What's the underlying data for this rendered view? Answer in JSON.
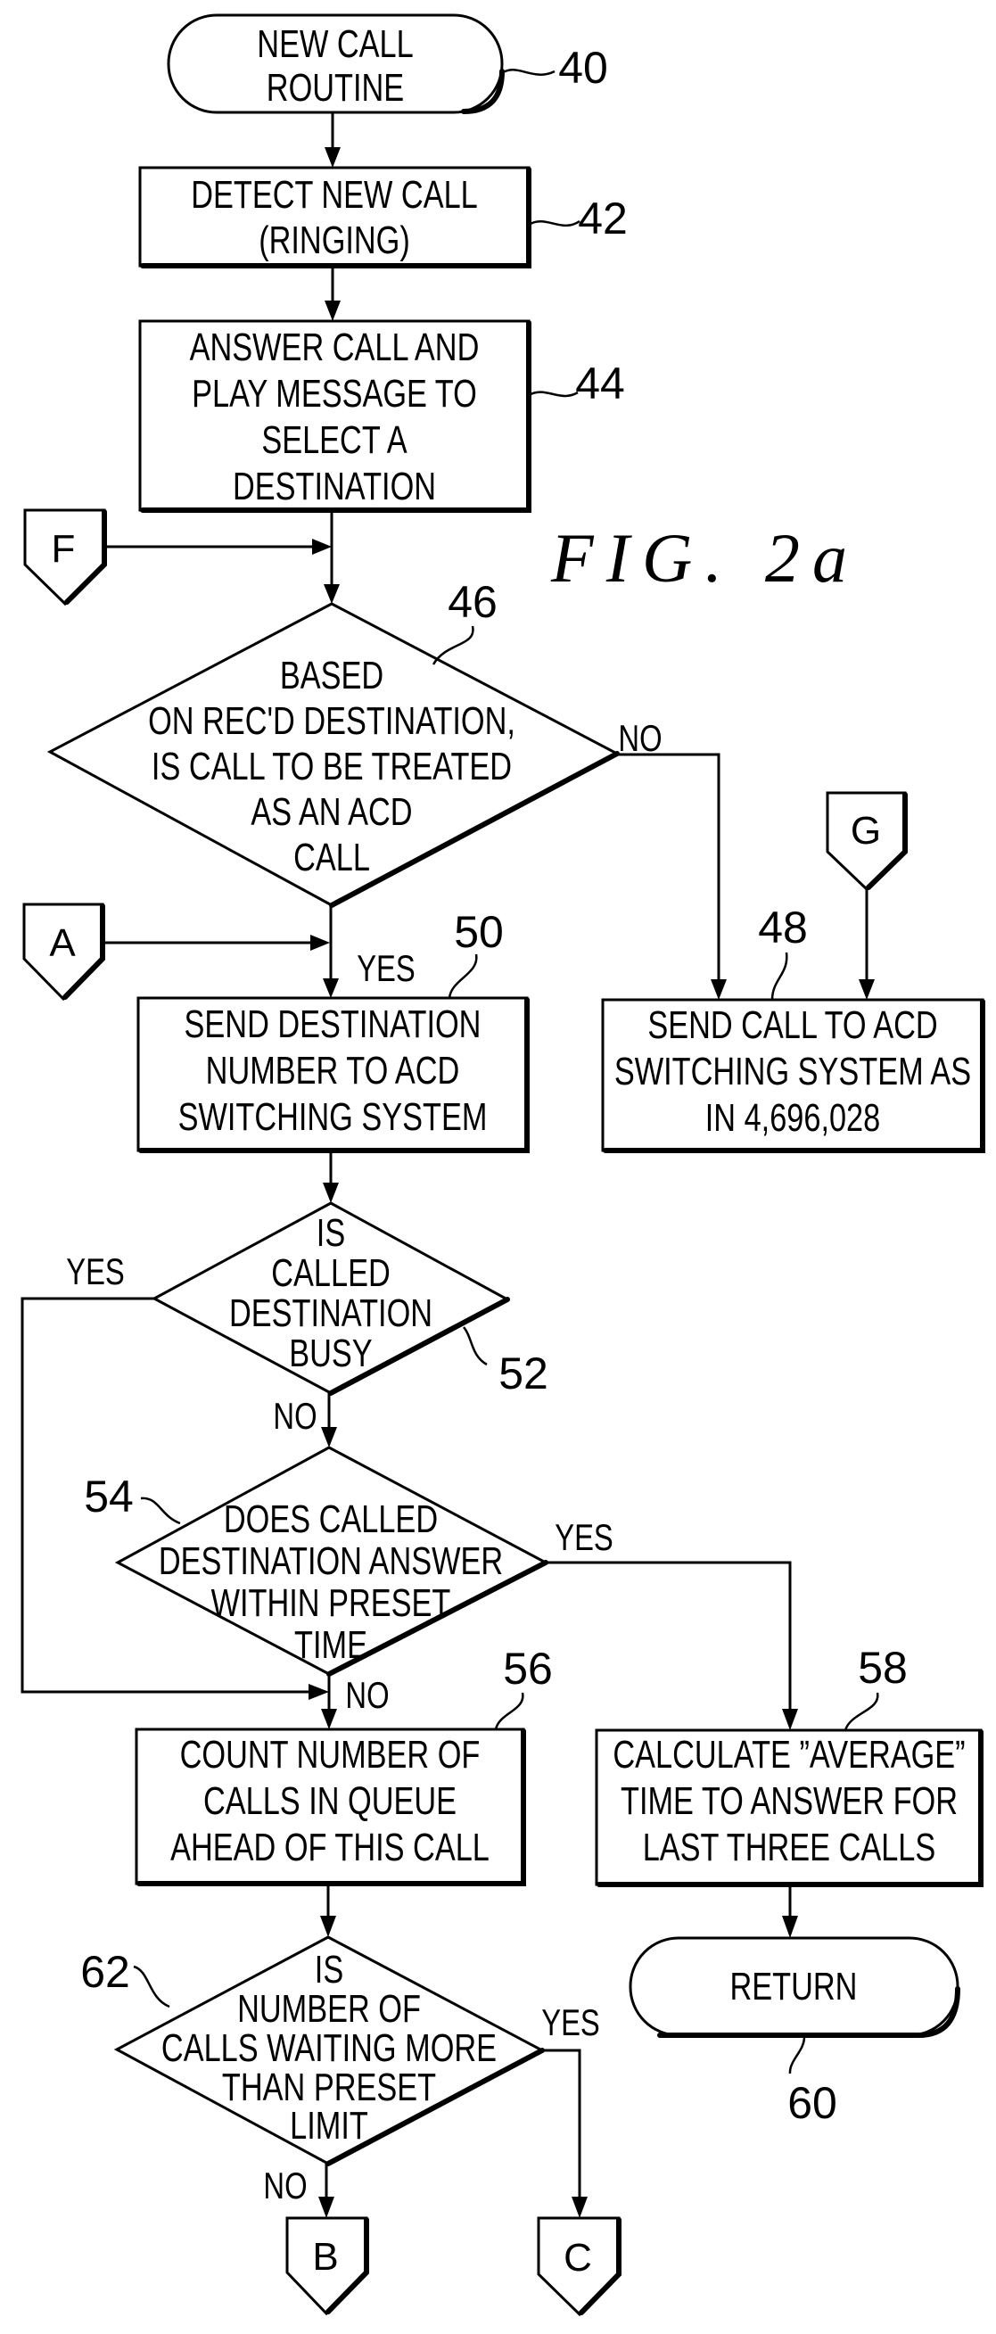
{
  "figure_title": "FIG.  2a",
  "nodes": {
    "n40": {
      "ref": "40",
      "lines": [
        "NEW CALL",
        "ROUTINE"
      ]
    },
    "n42": {
      "ref": "42",
      "lines": [
        "DETECT NEW CALL",
        "(RINGING)"
      ]
    },
    "n44": {
      "ref": "44",
      "lines": [
        "ANSWER CALL AND",
        "PLAY MESSAGE TO",
        "SELECT A",
        "DESTINATION"
      ]
    },
    "n46": {
      "ref": "46",
      "lines": [
        "BASED",
        "ON REC'D DESTINATION,",
        "IS CALL TO BE TREATED",
        "AS AN ACD",
        "CALL"
      ]
    },
    "n48": {
      "ref": "48",
      "lines": [
        "SEND CALL TO ACD",
        "SWITCHING SYSTEM AS",
        "IN 4,696,028"
      ]
    },
    "n50": {
      "ref": "50",
      "lines": [
        "SEND DESTINATION",
        "NUMBER TO ACD",
        "SWITCHING SYSTEM"
      ]
    },
    "n52": {
      "ref": "52",
      "lines": [
        "IS",
        "CALLED",
        "DESTINATION",
        "BUSY"
      ]
    },
    "n54": {
      "ref": "54",
      "lines": [
        "DOES CALLED",
        "DESTINATION ANSWER",
        "WITHIN PRESET",
        "TIME"
      ]
    },
    "n56": {
      "ref": "56",
      "lines": [
        "COUNT NUMBER OF",
        "CALLS IN QUEUE",
        "AHEAD OF THIS CALL"
      ]
    },
    "n58": {
      "ref": "58",
      "lines": [
        "CALCULATE ”AVERAGE”",
        "TIME TO ANSWER FOR",
        "LAST THREE CALLS"
      ]
    },
    "n60": {
      "ref": "60",
      "lines": [
        "RETURN"
      ]
    },
    "n62": {
      "ref": "62",
      "lines": [
        "IS",
        "NUMBER OF",
        "CALLS WAITING MORE",
        "THAN PRESET",
        "LIMIT"
      ]
    }
  },
  "connectors": {
    "F": "F",
    "A": "A",
    "G": "G",
    "B": "B",
    "C": "C"
  },
  "edge_labels": {
    "n46_no": "NO",
    "n46_yes": "YES",
    "n52_yes": "YES",
    "n52_no": "NO",
    "n54_yes": "YES",
    "n54_no": "NO",
    "n62_yes": "YES",
    "n62_no": "NO"
  }
}
